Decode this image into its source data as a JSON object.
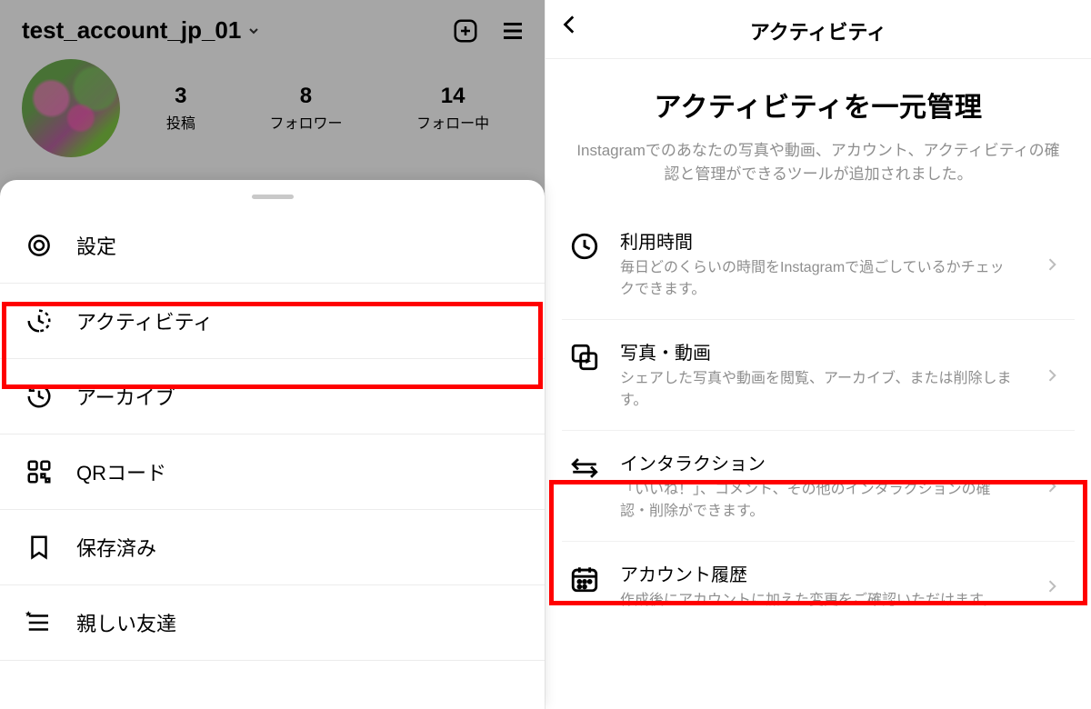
{
  "left": {
    "username": "test_account_jp_01",
    "stats": {
      "posts": {
        "value": "3",
        "label": "投稿"
      },
      "followers": {
        "value": "8",
        "label": "フォロワー"
      },
      "following": {
        "value": "14",
        "label": "フォロー中"
      }
    },
    "menu": {
      "settings": "設定",
      "activity": "アクティビティ",
      "archive": "アーカイブ",
      "qrcode": "QRコード",
      "saved": "保存済み",
      "close_friends": "親しい友達"
    }
  },
  "right": {
    "header_title": "アクティビティ",
    "hero_title": "アクティビティを一元管理",
    "hero_subtitle": "Instagramでのあなたの写真や動画、アカウント、アクティビティの確認と管理ができるツールが追加されました。",
    "items": {
      "time": {
        "title": "利用時間",
        "subtitle": "毎日どのくらいの時間をInstagramで過ごしているかチェックできます。"
      },
      "media": {
        "title": "写真・動画",
        "subtitle": "シェアした写真や動画を閲覧、アーカイブ、または削除します。"
      },
      "interactions": {
        "title": "インタラクション",
        "subtitle": "「いいね！」、コメント、その他のインタラクションの確認・削除ができます。"
      },
      "history": {
        "title": "アカウント履歴",
        "subtitle": "作成後にアカウントに加えた変更をご確認いただけます。"
      }
    }
  }
}
